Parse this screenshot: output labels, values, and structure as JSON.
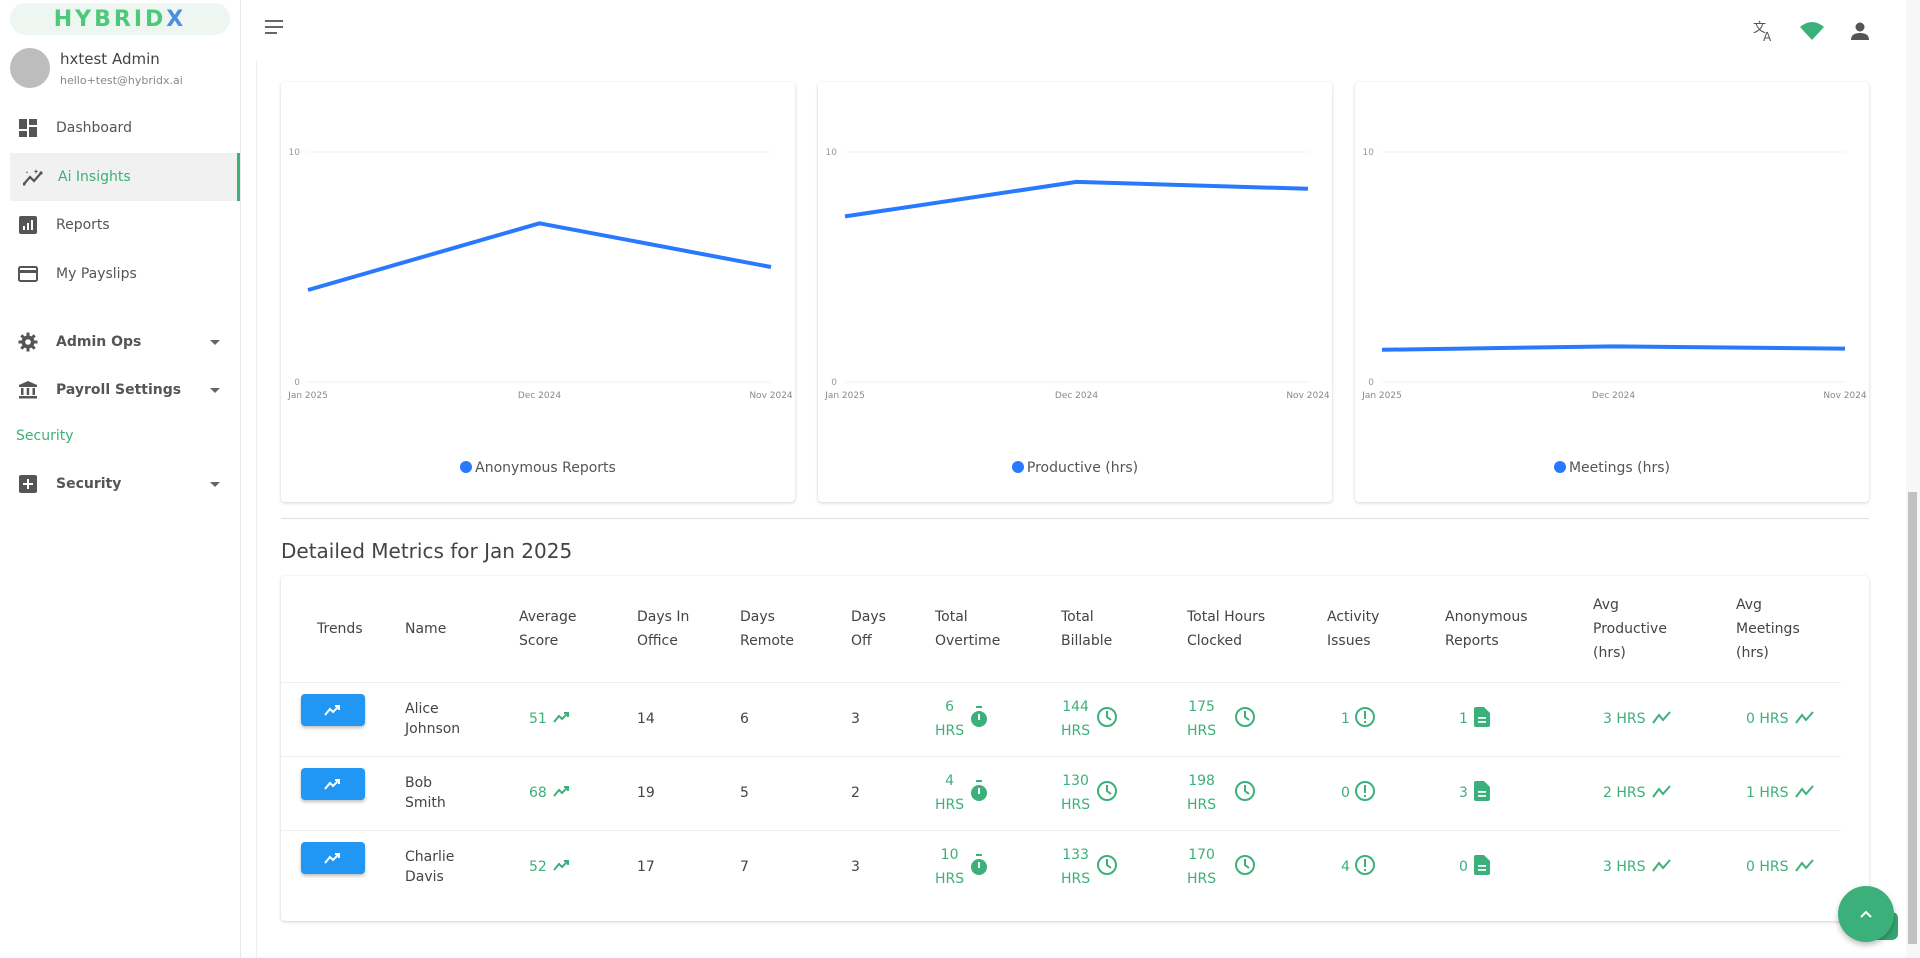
{
  "app": {
    "logo_main": "HYBRID",
    "logo_accent": "X"
  },
  "user": {
    "name": "hxtest Admin",
    "email": "hello+test@hybridx.ai"
  },
  "sidebar": {
    "items": [
      {
        "label": "Dashboard",
        "icon": "dashboard-icon"
      },
      {
        "label": "Ai Insights",
        "icon": "insights-icon",
        "active": true
      },
      {
        "label": "Reports",
        "icon": "bar-chart-icon"
      },
      {
        "label": "My Payslips",
        "icon": "credit-card-icon"
      },
      {
        "label": "Admin Ops",
        "icon": "gear-icon",
        "expandable": true
      },
      {
        "label": "Payroll Settings",
        "icon": "bank-icon",
        "expandable": true
      },
      {
        "label": "Security",
        "icon": "plus-box-icon",
        "expandable": true
      }
    ],
    "section_label": "Security"
  },
  "header": {
    "icons": [
      "translate-icon",
      "wifi-icon",
      "account-icon"
    ]
  },
  "chart_data": [
    {
      "type": "line",
      "title": "",
      "categories": [
        "Jan 2025",
        "Dec 2024",
        "Nov 2024"
      ],
      "series": [
        {
          "name": "Anonymous Reports",
          "values": [
            4.0,
            6.9,
            5.0
          ],
          "color": "#2979ff"
        }
      ],
      "yticks": [
        "0",
        "10"
      ],
      "ylim": [
        0,
        10
      ],
      "grid": true,
      "legend": "bottom-center"
    },
    {
      "type": "line",
      "title": "",
      "categories": [
        "Jan 2025",
        "Dec 2024",
        "Nov 2024"
      ],
      "series": [
        {
          "name": "Productive (hrs)",
          "values": [
            7.2,
            8.7,
            8.4
          ],
          "color": "#2979ff"
        }
      ],
      "yticks": [
        "0",
        "10"
      ],
      "ylim": [
        0,
        10
      ],
      "grid": true,
      "legend": "bottom-center"
    },
    {
      "type": "line",
      "title": "",
      "categories": [
        "Jan 2025",
        "Dec 2024",
        "Nov 2024"
      ],
      "series": [
        {
          "name": "Meetings (hrs)",
          "values": [
            1.4,
            1.55,
            1.45
          ],
          "color": "#2979ff"
        }
      ],
      "yticks": [
        "0",
        "10"
      ],
      "ylim": [
        0,
        10
      ],
      "grid": true,
      "legend": "bottom-center"
    }
  ],
  "metrics": {
    "title": "Detailed Metrics for Jan 2025",
    "columns": [
      "Trends",
      "Name",
      "Average Score",
      "Days In Office",
      "Days Remote",
      "Days Off",
      "Total Overtime",
      "Total Billable",
      "Total Hours Clocked",
      "Activity Issues",
      "Anonymous Reports",
      "Avg Productive (hrs)",
      "Avg Meetings (hrs)"
    ],
    "unit": "HRS",
    "rows": [
      {
        "first": "Alice",
        "last": "Johnson",
        "score": "51",
        "office": "14",
        "remote": "6",
        "off": "3",
        "overtime": "6",
        "billable": "144",
        "clocked": "175",
        "issues": "1",
        "reports": "1",
        "productive": "3 HRS",
        "meetings": "0 HRS"
      },
      {
        "first": "Bob",
        "last": "Smith",
        "score": "68",
        "office": "19",
        "remote": "5",
        "off": "2",
        "overtime": "4",
        "billable": "130",
        "clocked": "198",
        "issues": "0",
        "reports": "3",
        "productive": "2 HRS",
        "meetings": "1 HRS"
      },
      {
        "first": "Charlie",
        "last": "Davis",
        "score": "52",
        "office": "17",
        "remote": "7",
        "off": "3",
        "overtime": "10",
        "billable": "133",
        "clocked": "170",
        "issues": "4",
        "reports": "0",
        "productive": "3 HRS",
        "meetings": "0 HRS"
      }
    ]
  },
  "colors": {
    "accent": "#3cb07a",
    "chart_line": "#2979ff",
    "trend_button": "#2196f3"
  }
}
